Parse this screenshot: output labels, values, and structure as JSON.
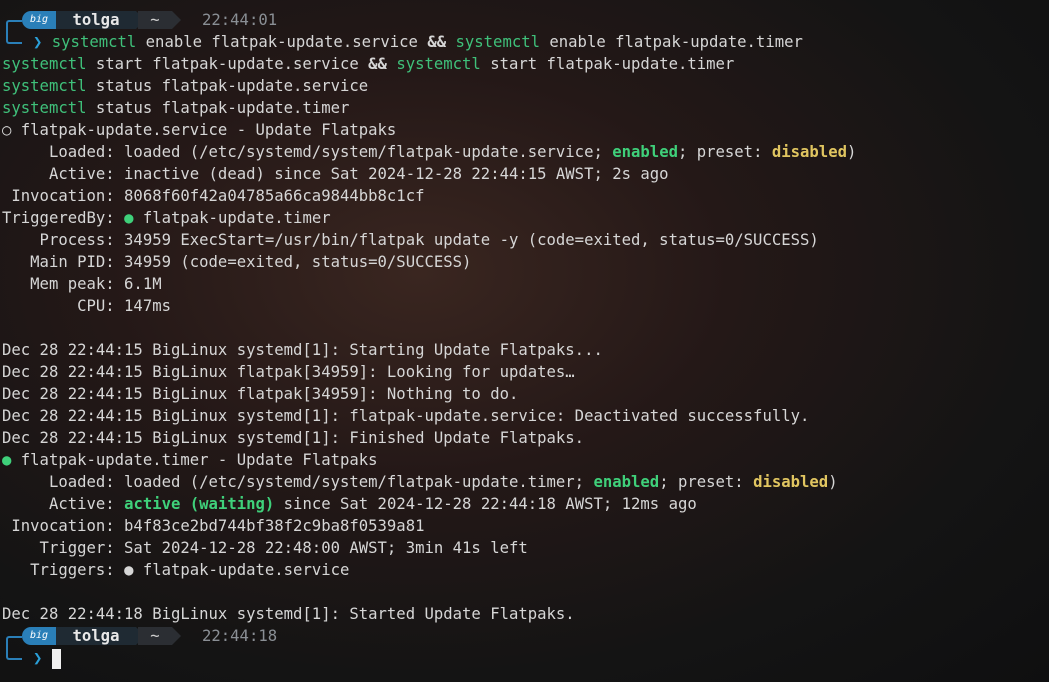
{
  "prompt1": {
    "logo": "big",
    "user": "tolga",
    "dir": "~",
    "time": "22:44:01"
  },
  "prompt2": {
    "logo": "big",
    "user": "tolga",
    "dir": "~",
    "time": "22:44:18"
  },
  "chevron": "❯",
  "command": {
    "l1_a": "systemctl",
    "l1_b": " enable flatpak-update.service ",
    "l1_amp": "&&",
    "l1_c": " ",
    "l1_d": "systemctl",
    "l1_e": " enable flatpak-update.timer",
    "l2_a": "systemctl",
    "l2_b": " start flatpak-update.service ",
    "l2_amp": "&&",
    "l2_c": " ",
    "l2_d": "systemctl",
    "l2_e": " start flatpak-update.timer",
    "l3_a": "systemctl",
    "l3_b": " status flatpak-update.service",
    "l4_a": "systemctl",
    "l4_b": " status flatpak-update.timer"
  },
  "service": {
    "header_dot": "○",
    "header": " flatpak-update.service - Update Flatpaks",
    "loaded_pre": "     Loaded: loaded (/etc/systemd/system/flatpak-update.service; ",
    "loaded_enabled": "enabled",
    "loaded_mid": "; preset: ",
    "loaded_disabled": "disabled",
    "loaded_post": ")",
    "active": "     Active: inactive (dead) since Sat 2024-12-28 22:44:15 AWST; 2s ago",
    "invocation": " Invocation: 8068f60f42a04785a66ca9844bb8c1cf",
    "triggeredby_pre": "TriggeredBy: ",
    "triggeredby_dot": "●",
    "triggeredby_post": " flatpak-update.timer",
    "process": "    Process: 34959 ExecStart=/usr/bin/flatpak update -y (code=exited, status=0/SUCCESS)",
    "mainpid": "   Main PID: 34959 (code=exited, status=0/SUCCESS)",
    "mempeak": "   Mem peak: 6.1M",
    "cpu": "        CPU: 147ms",
    "log": [
      "Dec 28 22:44:15 BigLinux systemd[1]: Starting Update Flatpaks...",
      "Dec 28 22:44:15 BigLinux flatpak[34959]: Looking for updates…",
      "Dec 28 22:44:15 BigLinux flatpak[34959]: Nothing to do.",
      "Dec 28 22:44:15 BigLinux systemd[1]: flatpak-update.service: Deactivated successfully.",
      "Dec 28 22:44:15 BigLinux systemd[1]: Finished Update Flatpaks."
    ]
  },
  "timer": {
    "header_dot": "●",
    "header": " flatpak-update.timer - Update Flatpaks",
    "loaded_pre": "     Loaded: loaded (/etc/systemd/system/flatpak-update.timer; ",
    "loaded_enabled": "enabled",
    "loaded_mid": "; preset: ",
    "loaded_disabled": "disabled",
    "loaded_post": ")",
    "active_pre": "     Active: ",
    "active_state": "active (waiting)",
    "active_post": " since Sat 2024-12-28 22:44:18 AWST; 12ms ago",
    "invocation": " Invocation: b4f83ce2bd744bf38f2c9ba8f0539a81",
    "trigger": "    Trigger: Sat 2024-12-28 22:48:00 AWST; 3min 41s left",
    "triggers_pre": "   Triggers: ",
    "triggers_dot": "●",
    "triggers_post": " flatpak-update.service",
    "log": [
      "Dec 28 22:44:18 BigLinux systemd[1]: Started Update Flatpaks."
    ]
  }
}
